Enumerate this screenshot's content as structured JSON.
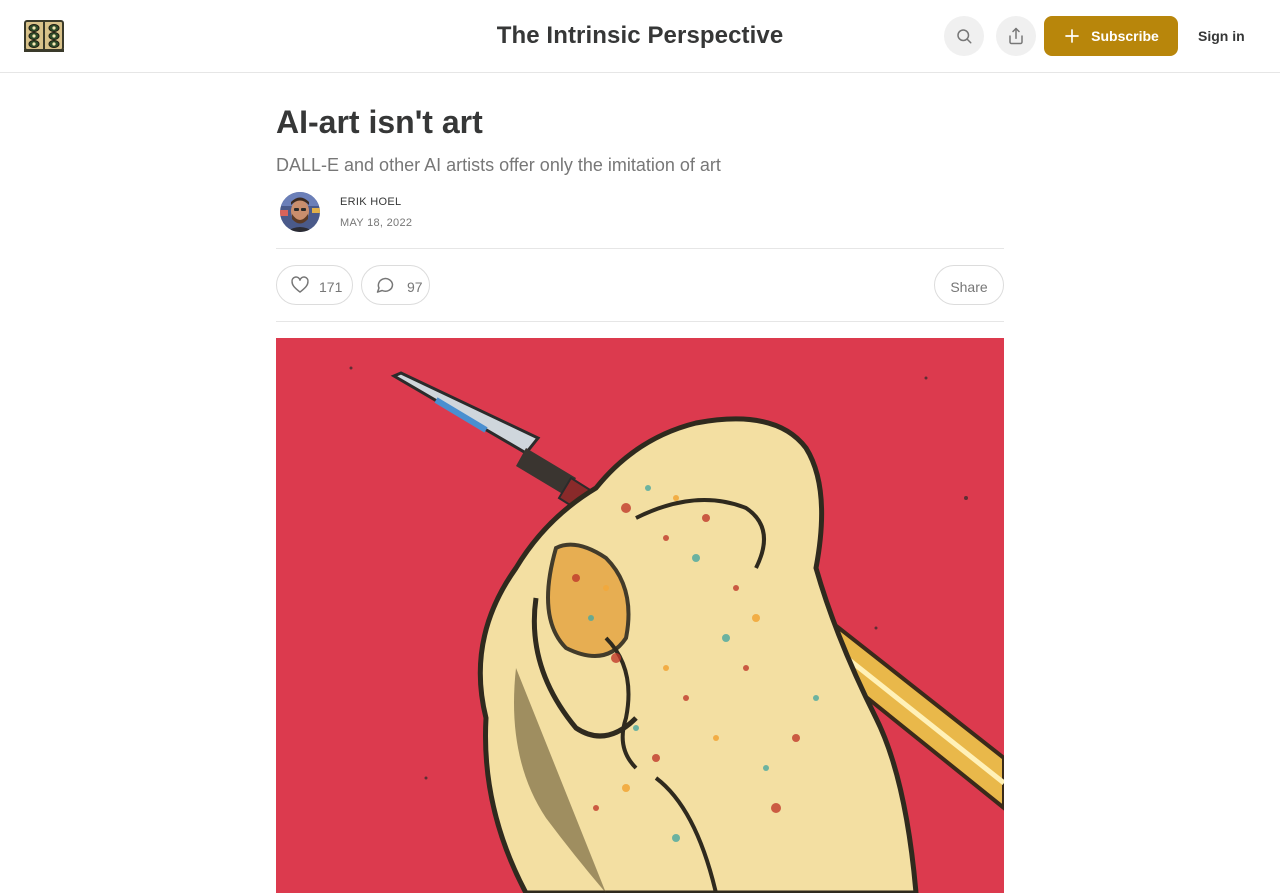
{
  "header": {
    "publication_title": "The Intrinsic Perspective",
    "subscribe_label": "Subscribe",
    "signin_label": "Sign in",
    "logo_icon": "book-logo-icon",
    "search_icon": "search-icon",
    "share_icon": "share-icon"
  },
  "article": {
    "title": "AI-art isn't art",
    "subtitle": "DALL-E and other AI artists offer only the imitation of art",
    "author": "ERIK HOEL",
    "date": "MAY 18, 2022",
    "likes": "171",
    "comments": "97",
    "share_label": "Share"
  },
  "colors": {
    "accent": "#b8860b",
    "hero_background": "#dc3a4e",
    "text": "#363737",
    "muted": "#777777"
  }
}
